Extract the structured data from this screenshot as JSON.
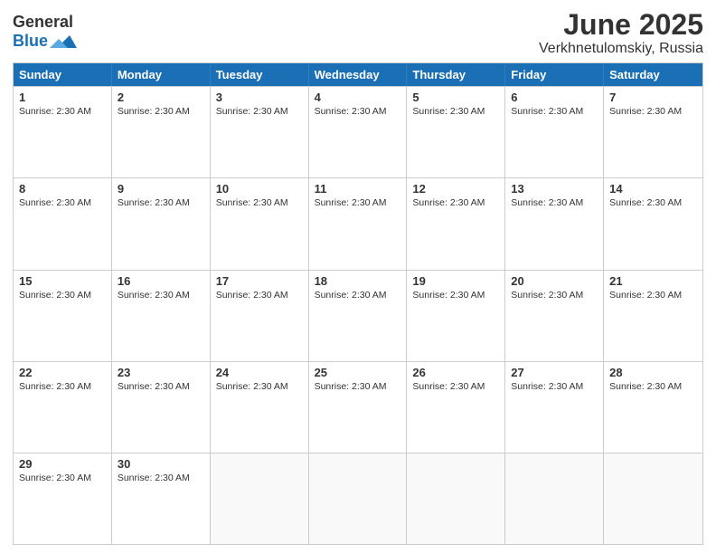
{
  "logo": {
    "text_general": "General",
    "text_blue": "Blue"
  },
  "title": {
    "month_year": "June 2025",
    "location": "Verkhnetulomskiy, Russia"
  },
  "header_days": [
    "Sunday",
    "Monday",
    "Tuesday",
    "Wednesday",
    "Thursday",
    "Friday",
    "Saturday"
  ],
  "sunrise_text": "Sunrise: 2:30 AM",
  "weeks": [
    [
      {
        "day": "1",
        "sunrise": "Sunrise: 2:30 AM"
      },
      {
        "day": "2",
        "sunrise": "Sunrise: 2:30 AM"
      },
      {
        "day": "3",
        "sunrise": "Sunrise: 2:30 AM"
      },
      {
        "day": "4",
        "sunrise": "Sunrise: 2:30 AM"
      },
      {
        "day": "5",
        "sunrise": "Sunrise: 2:30 AM"
      },
      {
        "day": "6",
        "sunrise": "Sunrise: 2:30 AM"
      },
      {
        "day": "7",
        "sunrise": "Sunrise: 2:30 AM"
      }
    ],
    [
      {
        "day": "8",
        "sunrise": "Sunrise: 2:30 AM"
      },
      {
        "day": "9",
        "sunrise": "Sunrise: 2:30 AM"
      },
      {
        "day": "10",
        "sunrise": "Sunrise: 2:30 AM"
      },
      {
        "day": "11",
        "sunrise": "Sunrise: 2:30 AM"
      },
      {
        "day": "12",
        "sunrise": "Sunrise: 2:30 AM"
      },
      {
        "day": "13",
        "sunrise": "Sunrise: 2:30 AM"
      },
      {
        "day": "14",
        "sunrise": "Sunrise: 2:30 AM"
      }
    ],
    [
      {
        "day": "15",
        "sunrise": "Sunrise: 2:30 AM"
      },
      {
        "day": "16",
        "sunrise": "Sunrise: 2:30 AM"
      },
      {
        "day": "17",
        "sunrise": "Sunrise: 2:30 AM"
      },
      {
        "day": "18",
        "sunrise": "Sunrise: 2:30 AM"
      },
      {
        "day": "19",
        "sunrise": "Sunrise: 2:30 AM"
      },
      {
        "day": "20",
        "sunrise": "Sunrise: 2:30 AM"
      },
      {
        "day": "21",
        "sunrise": "Sunrise: 2:30 AM"
      }
    ],
    [
      {
        "day": "22",
        "sunrise": "Sunrise: 2:30 AM"
      },
      {
        "day": "23",
        "sunrise": "Sunrise: 2:30 AM"
      },
      {
        "day": "24",
        "sunrise": "Sunrise: 2:30 AM"
      },
      {
        "day": "25",
        "sunrise": "Sunrise: 2:30 AM"
      },
      {
        "day": "26",
        "sunrise": "Sunrise: 2:30 AM"
      },
      {
        "day": "27",
        "sunrise": "Sunrise: 2:30 AM"
      },
      {
        "day": "28",
        "sunrise": "Sunrise: 2:30 AM"
      }
    ],
    [
      {
        "day": "29",
        "sunrise": "Sunrise: 2:30 AM"
      },
      {
        "day": "30",
        "sunrise": "Sunrise: 2:30 AM"
      },
      {
        "day": "",
        "sunrise": ""
      },
      {
        "day": "",
        "sunrise": ""
      },
      {
        "day": "",
        "sunrise": ""
      },
      {
        "day": "",
        "sunrise": ""
      },
      {
        "day": "",
        "sunrise": ""
      }
    ]
  ]
}
